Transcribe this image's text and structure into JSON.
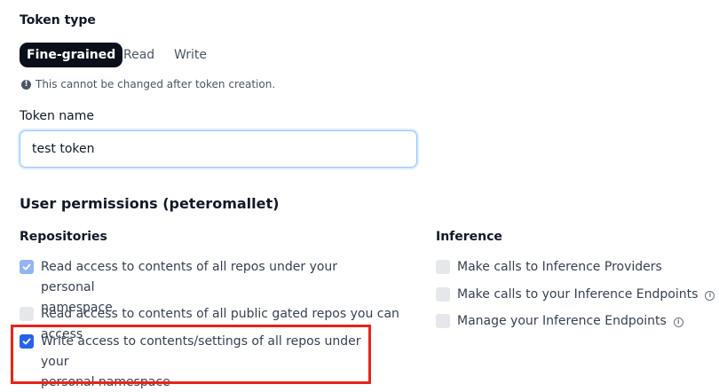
{
  "token_type": {
    "label": "Token type",
    "options": [
      "Fine-grained",
      "Read",
      "Write"
    ],
    "selected": "Fine-grained",
    "note": "This cannot be changed after token creation."
  },
  "token_name": {
    "label": "Token name",
    "value": "test token"
  },
  "user_permissions": {
    "heading": "User permissions (peteromallet)",
    "repositories": {
      "label": "Repositories",
      "items": [
        {
          "line1": "Read access to contents of all repos under your personal",
          "line2": "namespace",
          "checked": true,
          "disabled": true
        },
        {
          "line1": "Read access to contents of all public gated repos you can access",
          "line2": "",
          "checked": false,
          "disabled": false
        },
        {
          "line1": "Write access to contents/settings of all repos under your",
          "line2": "personal namespace",
          "checked": true,
          "disabled": false
        }
      ]
    },
    "inference": {
      "label": "Inference",
      "items": [
        {
          "text": "Make calls to Inference Providers",
          "checked": false,
          "has_info": false
        },
        {
          "text": "Make calls to your Inference Endpoints",
          "checked": false,
          "has_info": true
        },
        {
          "text": "Manage your Inference Endpoints",
          "checked": false,
          "has_info": true
        }
      ]
    }
  },
  "icons": {
    "note_icon": "info-circle-filled-icon",
    "checkmark": "check-icon",
    "info": "info-circle-icon"
  },
  "colors": {
    "pill_active_bg": "#0b0f19",
    "checkbox_checked": "#2563eb",
    "checkbox_checked_disabled": "#93b4f5",
    "highlight": "#e8231b",
    "input_focus": "#93c5fd"
  }
}
